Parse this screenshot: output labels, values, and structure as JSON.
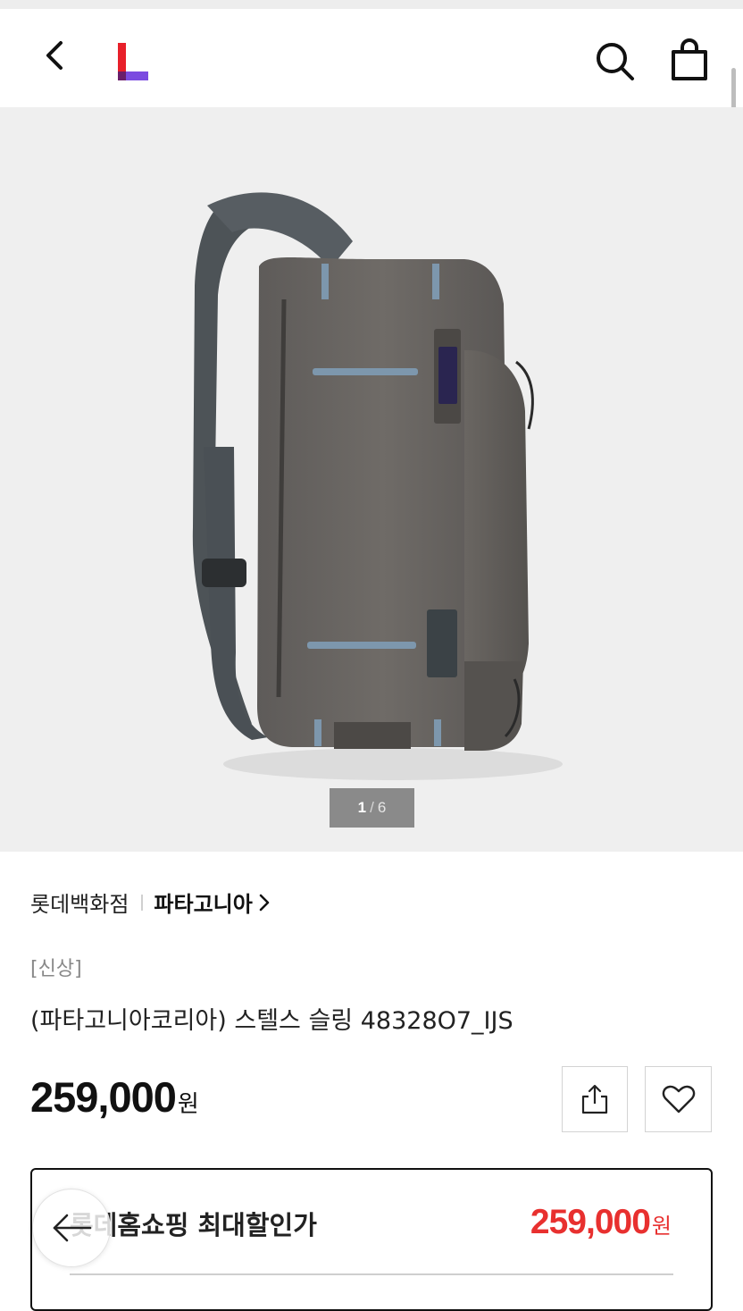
{
  "gallery": {
    "current": "1",
    "separator": "/",
    "total": "6"
  },
  "product": {
    "seller": "롯데백화점",
    "brand": "파타고니아",
    "tag": "[신상]",
    "title": "(파타고니아코리아) 스텔스 슬링 48328O7_IJS",
    "price": "259,000",
    "currency": "원"
  },
  "offer": {
    "label": "롯데홈쇼핑 최대할인가",
    "price": "259,000",
    "currency": "원"
  },
  "colors": {
    "accent_red": "#e8302f",
    "logo_red": "#e8202a",
    "logo_purple": "#7b4be0"
  },
  "icons": {
    "back": "chevron-left-icon",
    "logo": "lotteon-logo",
    "search": "search-icon",
    "bag": "shopping-bag-icon",
    "share": "share-icon",
    "wish": "heart-icon",
    "float_back": "arrow-left-icon"
  }
}
